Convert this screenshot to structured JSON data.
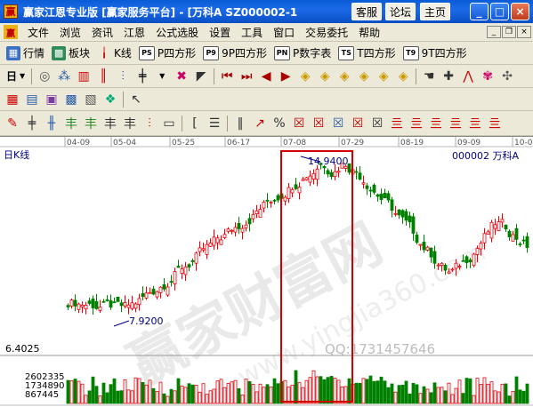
{
  "window": {
    "title": "赢家江恩专业版 [赢家服务平台] - [万科A   SZ000002-1",
    "btn_service": "客服",
    "btn_forum": "论坛",
    "btn_home": "主页",
    "minimize": "_",
    "maximize": "□",
    "close": "×"
  },
  "menubar": {
    "items": [
      "文件",
      "浏览",
      "资讯",
      "江恩",
      "公式选股",
      "设置",
      "工具",
      "窗口",
      "交易委托",
      "帮助"
    ]
  },
  "toolbar1": {
    "items": [
      "行情",
      "板块",
      "K线",
      "P四方形",
      "9P四方形",
      "P数字表",
      "T四方形",
      "9T四方形"
    ],
    "icon_codes": [
      "",
      "",
      "",
      "PS",
      "P9",
      "9P",
      "PN",
      "TS",
      "T9"
    ]
  },
  "toolbar1_icons": {
    "ps": "PS",
    "p9": "P9",
    "pn": "PN",
    "ts": "TS",
    "t9": "T9"
  },
  "toolbar2": {
    "period": "日"
  },
  "chart": {
    "period_label": "日K线",
    "stock_label": "000002  万科A",
    "dates": [
      "04-09",
      "05-04",
      "05-25",
      "06-17",
      "07-08",
      "07-29",
      "08-19",
      "09-09",
      "10-0"
    ],
    "high_label": "14.9400",
    "low_label": "7.9200",
    "price_level": "6.4025",
    "volume_levels": [
      "2602335",
      "1734890",
      "867445"
    ],
    "watermark_qq": "QQ:1731457646",
    "watermark_cn": "赢家财富网",
    "watermark_url": "www.yingjia360.com",
    "colors": {
      "up": "#e8000a",
      "down": "#008000",
      "highlight": "#d40000",
      "axis_text": "#000080"
    }
  }
}
